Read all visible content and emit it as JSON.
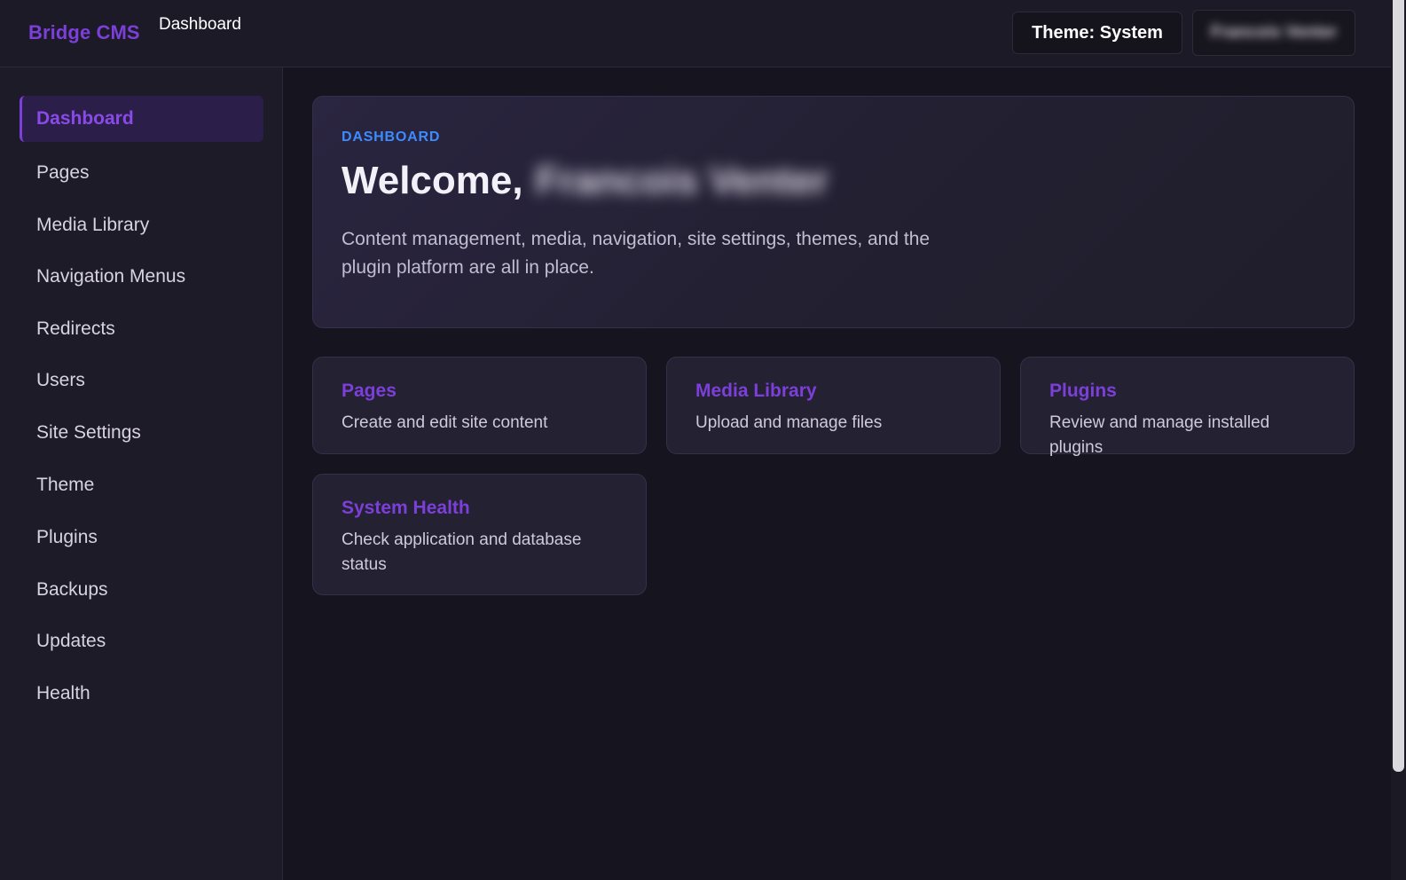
{
  "header": {
    "brand": "Bridge CMS",
    "page_heading": "Dashboard",
    "theme_button": "Theme: System",
    "user_button": "Francois Venter"
  },
  "sidebar": {
    "items": [
      {
        "label": "Dashboard",
        "active": true
      },
      {
        "label": "Pages"
      },
      {
        "label": "Media Library"
      },
      {
        "label": "Navigation Menus"
      },
      {
        "label": "Redirects"
      },
      {
        "label": "Users"
      },
      {
        "label": "Site Settings"
      },
      {
        "label": "Theme"
      },
      {
        "label": "Plugins"
      },
      {
        "label": "Backups"
      },
      {
        "label": "Updates"
      },
      {
        "label": "Health"
      }
    ]
  },
  "hero": {
    "eyebrow": "DASHBOARD",
    "welcome_prefix": "Welcome,",
    "user_name": "Francois Venter",
    "description": "Content management, media, navigation, site settings, themes, and the plugin platform are all in place."
  },
  "cards": [
    {
      "title": "Pages",
      "description": "Create and edit site content"
    },
    {
      "title": "Media Library",
      "description": "Upload and manage files"
    },
    {
      "title": "Plugins",
      "description": "Review and manage installed plugins"
    },
    {
      "title": "System Health",
      "description": "Check application and database status"
    }
  ],
  "colors": {
    "accent": "#7c3fd9",
    "eyebrow": "#3d8bff",
    "background": "#16141e",
    "sidebar": "#1d1b28",
    "card": "#242132"
  }
}
